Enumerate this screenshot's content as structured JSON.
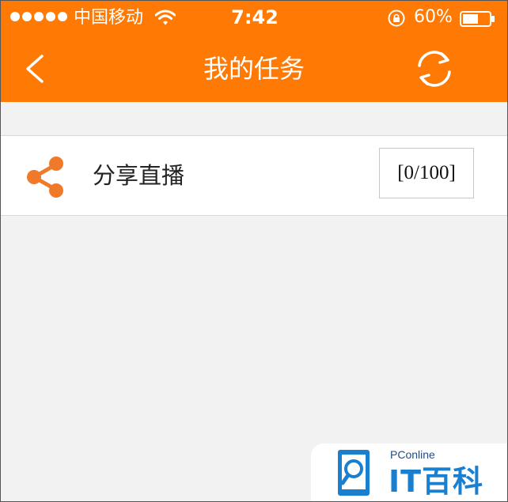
{
  "status_bar": {
    "carrier": "中国移动",
    "time": "7:42",
    "battery_percent": "60%",
    "battery_level": 0.6,
    "signal_dots": 5,
    "icons": [
      "signal-dots-icon",
      "wifi-icon",
      "rotation-lock-icon",
      "battery-icon"
    ]
  },
  "nav": {
    "title": "我的任务",
    "left_icon": "back-chevron-icon",
    "right_icon": "refresh-icon"
  },
  "tasks": [
    {
      "icon": "share-icon",
      "label": "分享直播",
      "progress": "[0/100]"
    }
  ],
  "watermark": {
    "small_text": "PConline",
    "big_text": "IT百科",
    "icon": "search-magnifier-logo-icon"
  },
  "colors": {
    "accent": "#ff7a05",
    "background": "#f3f2f2",
    "row_background": "#ffffff",
    "icon_orange": "#f07a2a",
    "watermark_blue": "#1a7fcf"
  }
}
